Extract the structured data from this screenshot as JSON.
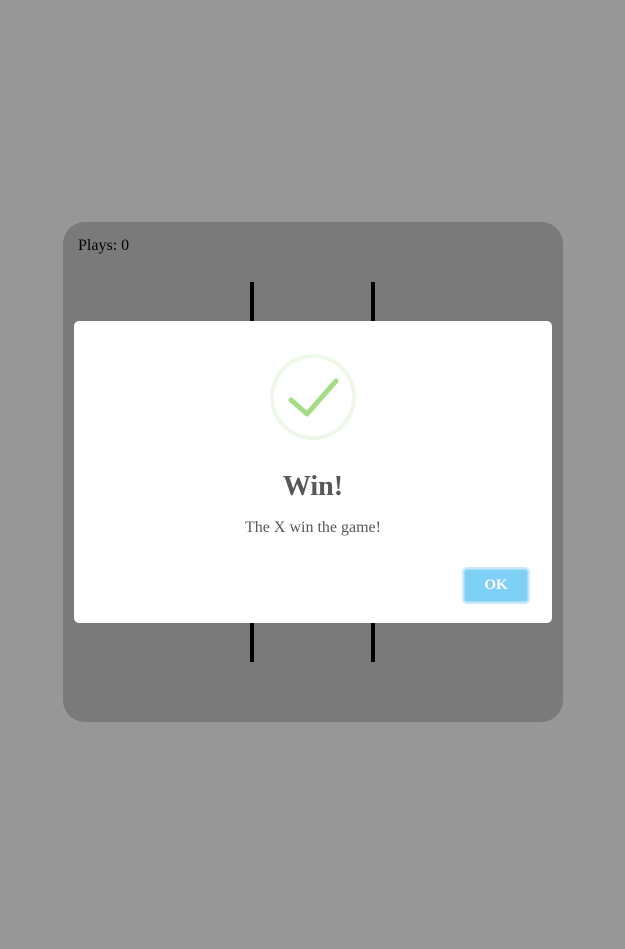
{
  "game": {
    "plays_label": "Plays: 0"
  },
  "dialog": {
    "icon": "success-check-icon",
    "title": "Win!",
    "message": "The X win the game!",
    "ok_label": "OK"
  },
  "colors": {
    "background": "#979797",
    "board": "#7a7a7a",
    "success": "#a5dc86",
    "ok_button": "#7fd0f6",
    "text": "#575757"
  }
}
